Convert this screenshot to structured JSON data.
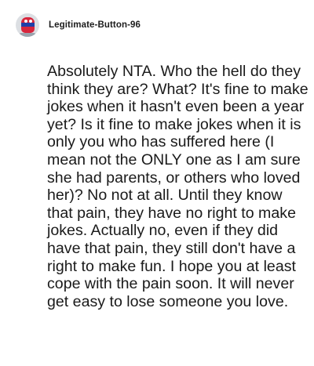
{
  "comment": {
    "author": "Legitimate-Button-96",
    "avatar_icon": "reddit-snoo-avatar-icon",
    "body": "Absolutely NTA. Who the hell do they think they are? What? It's fine to make jokes when it hasn't even been a year yet? Is it fine to make jokes when it is only you who has suffered here (I mean not the ONLY one as I am sure she had parents, or others who loved her)? No not at all. Until they know that pain, they have no right to make jokes. Actually no, even if they did have that pain, they still don't have a right to make fun. I hope you at least cope with the pain soon. It will never get easy to lose someone you love."
  }
}
